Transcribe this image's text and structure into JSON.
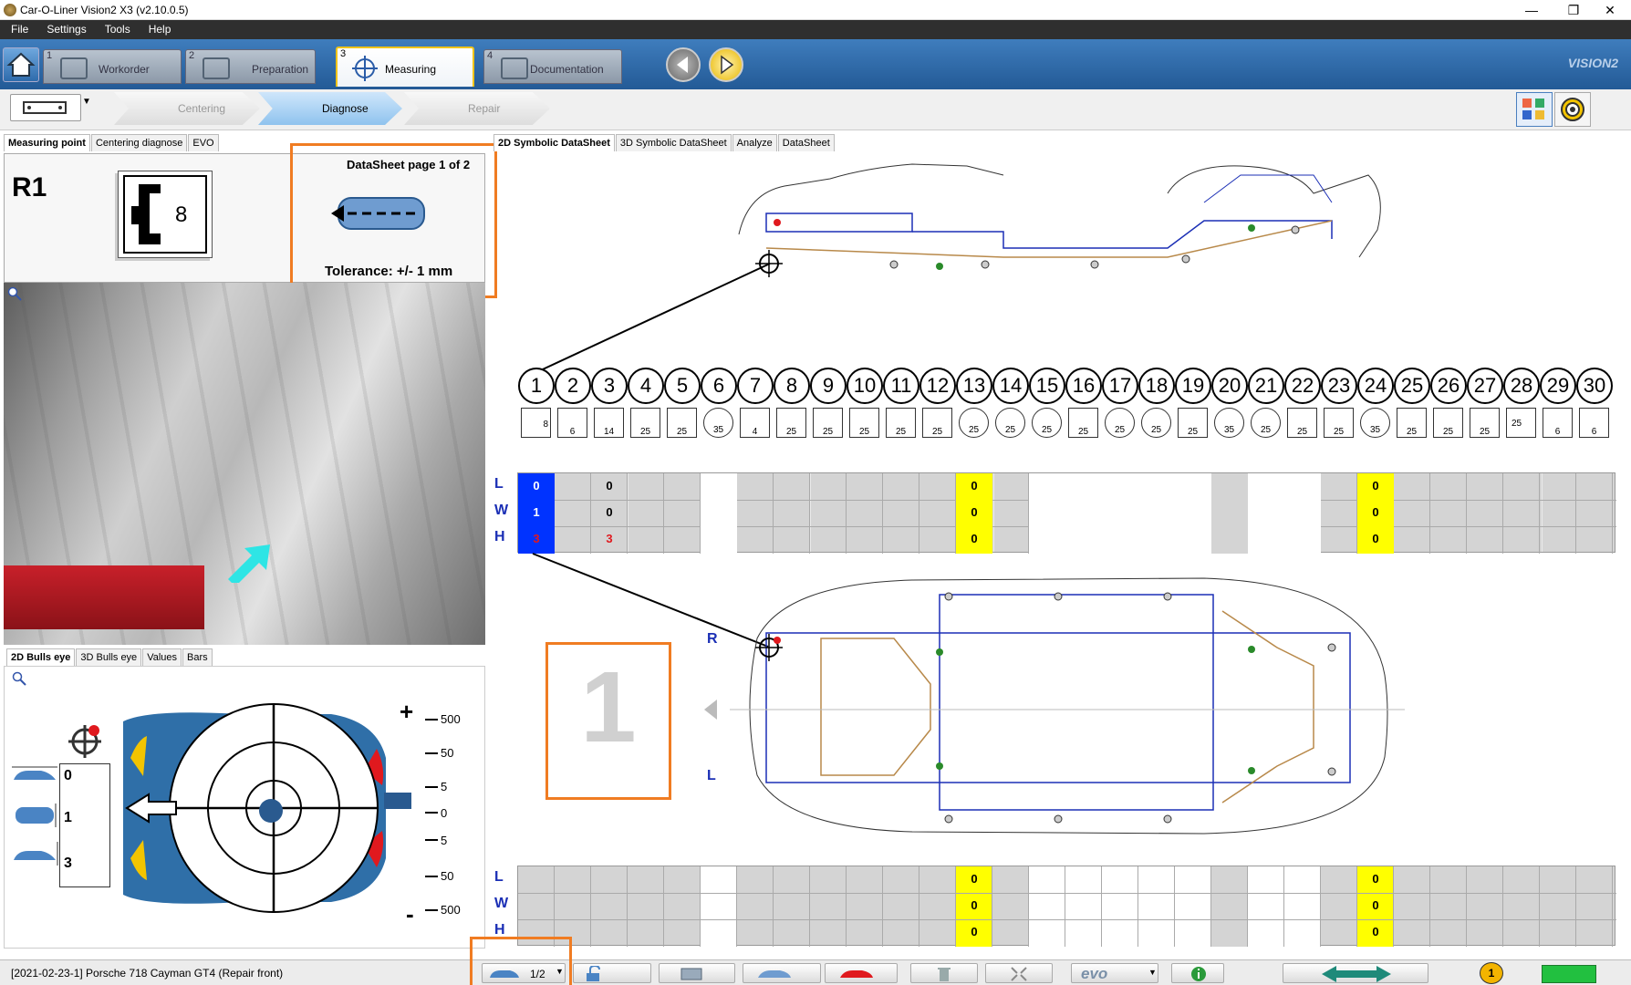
{
  "window": {
    "title": "Car-O-Liner Vision2 X3 (v2.10.0.5)",
    "min": "—",
    "max": "❐",
    "close": "✕"
  },
  "menu": [
    "File",
    "Settings",
    "Tools",
    "Help"
  ],
  "steps": [
    {
      "num": "1",
      "label": "Workorder"
    },
    {
      "num": "2",
      "label": "Preparation"
    },
    {
      "num": "3",
      "label": "Measuring"
    },
    {
      "num": "4",
      "label": "Documentation"
    }
  ],
  "brand": "VISION2",
  "substeps": [
    "Centering",
    "Diagnose",
    "Repair"
  ],
  "left_tabs": [
    "Measuring point",
    "Centering diagnose",
    "EVO"
  ],
  "point": {
    "id": "R1",
    "adapter": "8",
    "datasheet": "DataSheet page 1 of 2",
    "tolerance": "Tolerance: +/- 1 mm"
  },
  "bulls_tabs": [
    "2D Bulls eye",
    "3D Bulls eye",
    "Values",
    "Bars"
  ],
  "bulls_values": [
    "0",
    "1",
    "3"
  ],
  "scale": {
    "plus": "+",
    "minus": "-",
    "ticks": [
      "500",
      "50",
      "5",
      "0",
      "5",
      "50",
      "500"
    ]
  },
  "right_tabs": [
    "2D Symbolic DataSheet",
    "3D Symbolic DataSheet",
    "Analyze",
    "DataSheet"
  ],
  "points": [
    "1",
    "2",
    "3",
    "4",
    "5",
    "6",
    "7",
    "8",
    "9",
    "10",
    "11",
    "12",
    "13",
    "14",
    "15",
    "16",
    "17",
    "18",
    "19",
    "20",
    "21",
    "22",
    "23",
    "24",
    "25",
    "26",
    "27",
    "28",
    "29",
    "30"
  ],
  "adapters": [
    "8",
    "6",
    "14",
    "25",
    "25",
    "35",
    "4",
    "25",
    "25",
    "25",
    "25",
    "25",
    "25",
    "25",
    "25",
    "25",
    "25",
    "25",
    "25",
    "35",
    "25",
    "25",
    "25",
    "35",
    "25",
    "25",
    "25",
    "25",
    "6",
    "6"
  ],
  "row_labels": [
    "L",
    "W",
    "H"
  ],
  "top_values": {
    "c1": [
      "0",
      "1",
      "3"
    ],
    "c3": [
      "0",
      "0",
      "3"
    ],
    "c13": [
      "0",
      "0",
      "0"
    ],
    "c24": [
      "0",
      "0",
      "0"
    ]
  },
  "bottom_values": {
    "c13": [
      "0",
      "0",
      "0"
    ],
    "c24": [
      "0",
      "0",
      "0"
    ]
  },
  "side_labels": {
    "r": "R",
    "l": "L"
  },
  "big_number": "1",
  "status": {
    "text": "[2021-02-23-1]  Porsche 718 Cayman GT4 (Repair front)",
    "page": "1/2",
    "evo": "evo",
    "badge": "1"
  },
  "colors": {
    "accent": "#f07c22",
    "blue": "#0033ff",
    "yellow": "#ffff00",
    "red": "#e0191e"
  }
}
